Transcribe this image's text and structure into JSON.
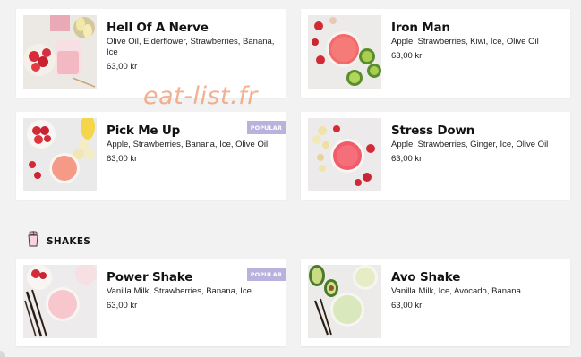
{
  "watermark": "eat-list.fr",
  "juices": [
    {
      "name": "Hell Of A Nerve",
      "ingredients": "Olive Oil, Elderflower, Strawberries, Banana, Ice",
      "price": "63,00 kr"
    },
    {
      "name": "Iron Man",
      "ingredients": "Apple, Strawberries, Kiwi, Ice, Olive Oil",
      "price": "63,00 kr"
    },
    {
      "name": "Pick Me Up",
      "ingredients": "Apple, Strawberries, Banana, Ice, Olive Oil",
      "price": "63,00 kr",
      "badge": "POPULAR"
    },
    {
      "name": "Stress Down",
      "ingredients": "Apple, Strawberries, Ginger, Ice, Olive Oil",
      "price": "63,00 kr"
    }
  ],
  "shakes_section": {
    "title": "SHAKES",
    "icon": "shake-cup-icon"
  },
  "shakes": [
    {
      "name": "Power Shake",
      "ingredients": "Vanilla Milk, Strawberries, Banana, Ice",
      "price": "63,00 kr",
      "badge": "POPULAR"
    },
    {
      "name": "Avo Shake",
      "ingredients": "Vanilla Milk, Ice, Avocado, Banana",
      "price": "63,00 kr"
    }
  ],
  "colors": {
    "badge": "#b8b2dd",
    "background": "#f3f2f2",
    "watermark": "#f2966e"
  }
}
